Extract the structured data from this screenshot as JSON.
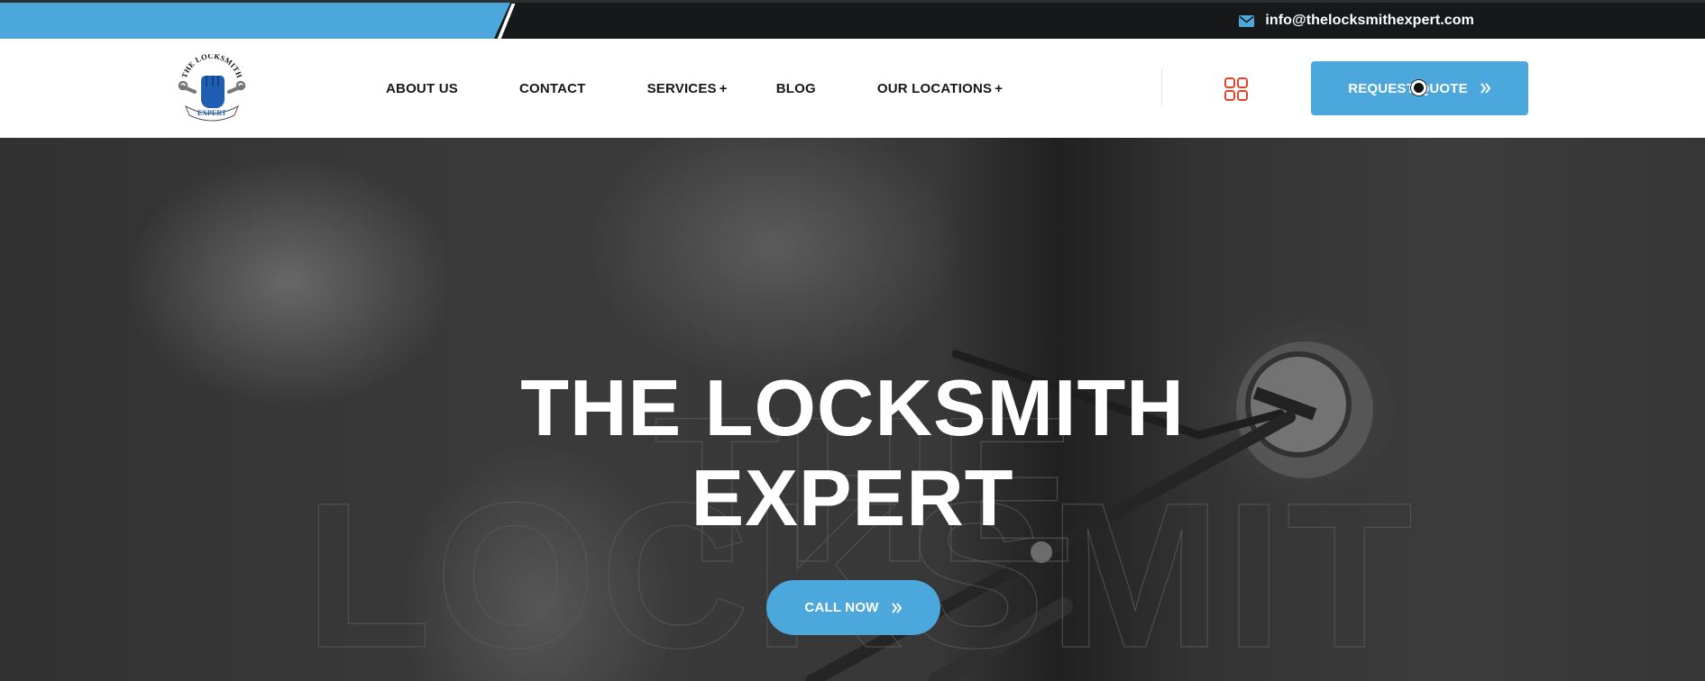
{
  "topbar": {
    "email": "info@thelocksmithexpert.com",
    "email_icon": "envelope-icon"
  },
  "logo": {
    "text_top": "THE LOCKSMITH",
    "text_bottom": "EXPERT"
  },
  "nav": {
    "items": [
      {
        "label": "ABOUT US"
      },
      {
        "label": "CONTACT"
      },
      {
        "label": "SERVICES",
        "suffix": "+"
      },
      {
        "label": "BLOG"
      },
      {
        "label": "OUR LOCATIONS",
        "suffix": "+"
      }
    ]
  },
  "header": {
    "menu_icon": "grid-menu-icon",
    "quote_label": "REQUEST QUOTE",
    "quote_icon": "double-chevron-right-icon"
  },
  "hero": {
    "title_line1": "THE LOCKSMITH",
    "title_line2": "EXPERT",
    "call_label": "CALL NOW",
    "call_icon": "double-chevron-right-icon"
  },
  "colors": {
    "accent": "#4ca8dc",
    "topbar_bg": "#161819",
    "menu_icon": "#e2442a",
    "logo_blue": "#1e5fb4"
  }
}
